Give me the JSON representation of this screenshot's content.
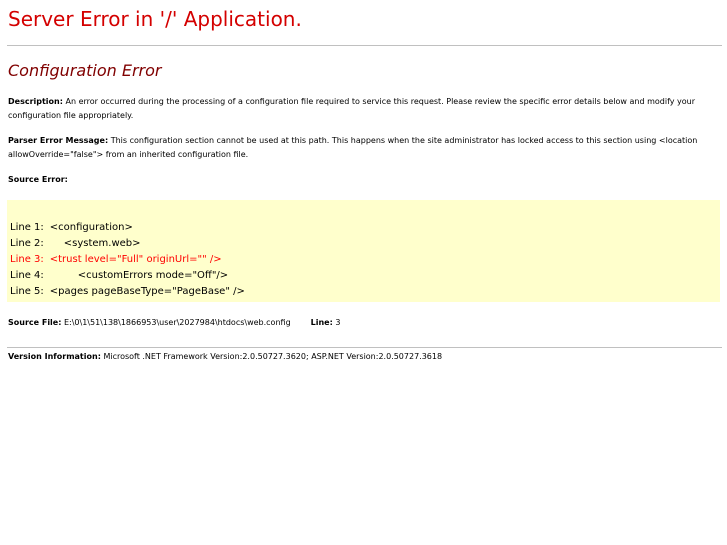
{
  "page": {
    "title": "Server Error in '/' Application.",
    "section_title": "Configuration Error"
  },
  "description": {
    "label": "Description:",
    "text": "An error occurred during the processing of a configuration file required to service this request. Please review the specific error details below and modify your configuration file appropriately."
  },
  "parser_error": {
    "label": "Parser Error Message:",
    "text": "This configuration section cannot be used at this path.  This happens when the site administrator has locked access to this section using <location allowOverride=\"false\"> from an inherited configuration file."
  },
  "source_error": {
    "label": "Source Error:",
    "lines": [
      {
        "number": "Line 1:",
        "code": "<configuration>",
        "indent": 0,
        "error": false
      },
      {
        "number": "Line 2:",
        "code": "<system.web>",
        "indent": 1,
        "error": false
      },
      {
        "number": "Line 3:",
        "code": "<trust level=\"Full\" originUrl=\"\" />",
        "indent": 0,
        "error": true
      },
      {
        "number": "Line 4:",
        "code": "<customErrors mode=\"Off\"/>",
        "indent": 2,
        "error": false
      },
      {
        "number": "Line 5:",
        "code": "<pages pageBaseType=\"PageBase\" />",
        "indent": 0,
        "error": false
      }
    ]
  },
  "source_file": {
    "label": "Source File:",
    "path": "E:\\0\\1\\51\\138\\1866953\\user\\2027984\\htdocs\\web.config",
    "line_label": "Line:",
    "line_value": "3"
  },
  "version": {
    "label": "Version Information:",
    "text": "Microsoft .NET Framework Version:2.0.50727.3620; ASP.NET Version:2.0.50727.3618"
  },
  "colors": {
    "title": "#d40000",
    "section_title": "#800000",
    "code_background": "#ffffcc",
    "error_line": "#ff0000",
    "divider": "#c0c0c0"
  }
}
